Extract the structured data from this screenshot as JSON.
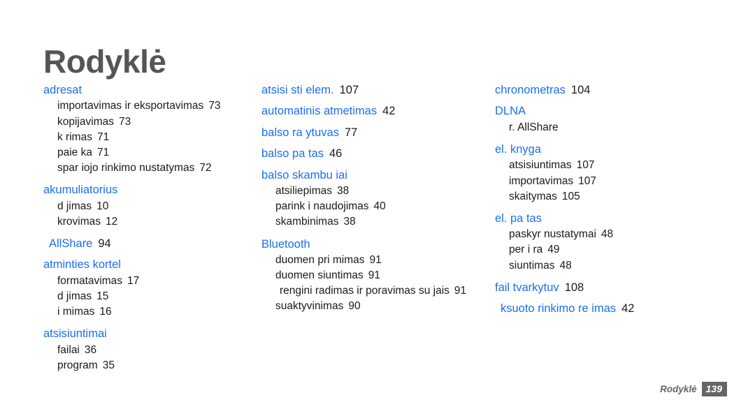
{
  "page": {
    "title": "Rodyklė",
    "accent_blue": "#1a6ff0",
    "title_gray": "#555555",
    "body_black": "#1a1a1a",
    "footer_gray": "#666666"
  },
  "footer": {
    "label": "Rodyklė",
    "page_number": "139"
  },
  "columns": [
    {
      "id": "column-1",
      "groups": [
        {
          "term": "adresat",
          "page": "",
          "subs": [
            {
              "label": "importavimas ir eksportavimas",
              "page": "73"
            },
            {
              "label": "kopijavimas",
              "page": "73"
            },
            {
              "label": "k rimas",
              "page": "71"
            },
            {
              "label": "paie ka",
              "page": "71"
            },
            {
              "label": "spar iojo rinkimo nustatymas",
              "page": "72"
            }
          ]
        },
        {
          "term": "akumuliatorius",
          "page": "",
          "subs": [
            {
              "label": "d jimas",
              "page": "10"
            },
            {
              "label": "krovimas",
              "page": "12"
            }
          ]
        },
        {
          "term": "AllShare",
          "page": "94",
          "subs": []
        },
        {
          "term": "atminties kortel",
          "page": "",
          "subs": [
            {
              "label": "formatavimas",
              "page": "17"
            },
            {
              "label": "d jimas",
              "page": "15"
            },
            {
              "label": "i mimas",
              "page": "16"
            }
          ]
        },
        {
          "term": "atsisiuntimai",
          "page": "",
          "subs": [
            {
              "label": "failai",
              "page": "36"
            },
            {
              "label": "program",
              "page": "35"
            }
          ]
        }
      ]
    },
    {
      "id": "column-2",
      "groups": [
        {
          "term": "atsisi sti elem.",
          "page": "107",
          "subs": []
        },
        {
          "term": "automatinis atmetimas",
          "page": "42",
          "subs": []
        },
        {
          "term": "balso  ra ytuvas",
          "page": "77",
          "subs": []
        },
        {
          "term": "balso pa tas",
          "page": "46",
          "subs": []
        },
        {
          "term": "balso skambu iai",
          "page": "",
          "subs": [
            {
              "label": "atsiliepimas",
              "page": "38"
            },
            {
              "label": "parink i  naudojimas",
              "page": "40"
            },
            {
              "label": "skambinimas",
              "page": "38"
            }
          ]
        },
        {
          "term": "Bluetooth",
          "page": "",
          "subs": [
            {
              "label": "duomen  pri mimas",
              "page": "91"
            },
            {
              "label": "duomen  siuntimas",
              "page": "91"
            },
            {
              "label": " rengini  radimas ir poravimas su jais",
              "page": "91"
            },
            {
              "label": "suaktyvinimas",
              "page": "90"
            }
          ]
        }
      ]
    },
    {
      "id": "column-3",
      "groups": [
        {
          "term": "chronometras",
          "page": "104",
          "subs": []
        },
        {
          "term": "DLNA",
          "page": "",
          "subs": [
            {
              "label": "r. AllShare",
              "page": ""
            }
          ]
        },
        {
          "term": "el. knyga",
          "page": "",
          "subs": [
            {
              "label": "atsisiuntimas",
              "page": "107"
            },
            {
              "label": "importavimas",
              "page": "107"
            },
            {
              "label": "skaitymas",
              "page": "105"
            }
          ]
        },
        {
          "term": "el. pa tas",
          "page": "",
          "subs": [
            {
              "label": "paskyr  nustatymai",
              "page": "48"
            },
            {
              "label": "per i ra",
              "page": "49"
            },
            {
              "label": "siuntimas",
              "page": "48"
            }
          ]
        },
        {
          "term": "fail  tvarkytuv",
          "page": "108",
          "subs": []
        },
        {
          "term": " ksuoto rinkimo re imas",
          "page": "42",
          "subs": []
        }
      ]
    }
  ]
}
